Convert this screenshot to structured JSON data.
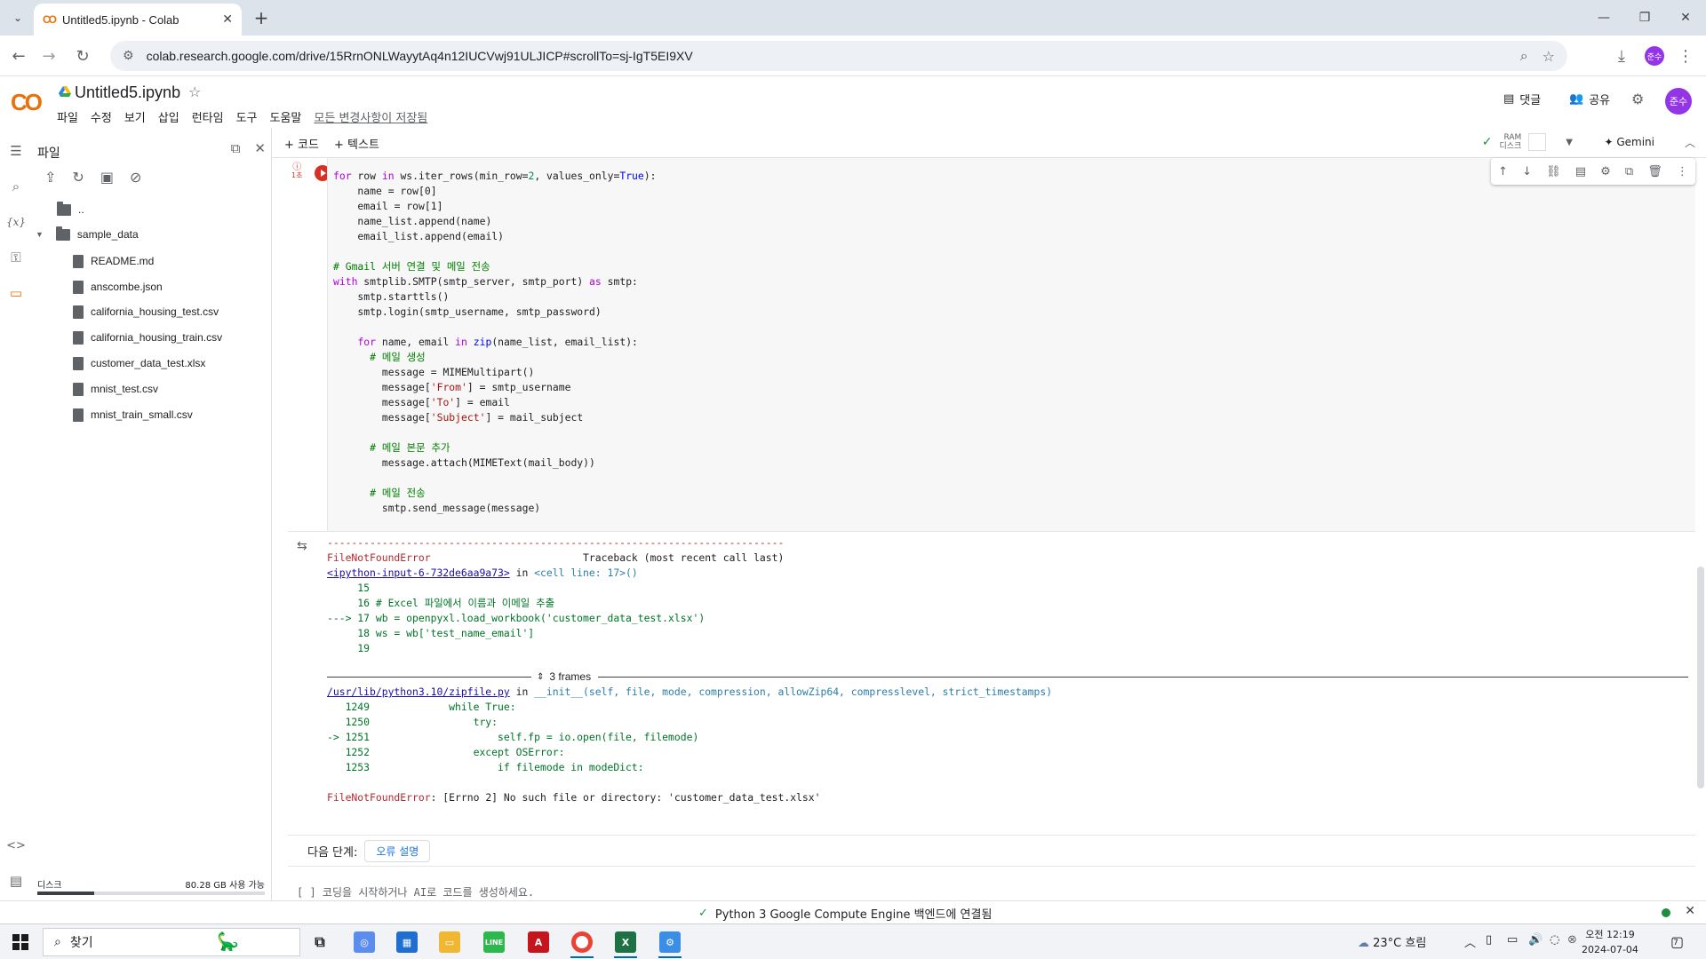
{
  "browser": {
    "tab_title": "Untitled5.ipynb - Colab",
    "tab_logo": "CO",
    "url": "colab.research.google.com/drive/15RrnONLWayytAq4n12IUCVwj91ULJICP#scrollTo=sj-IgT5EI9XV",
    "profile_initials": "준수"
  },
  "colab": {
    "logo": "CO",
    "notebook_title": "Untitled5.ipynb",
    "menu": [
      "파일",
      "수정",
      "보기",
      "삽입",
      "런타임",
      "도구",
      "도움말"
    ],
    "save_status": "모든 변경사항이 저장됨",
    "comments_label": "댓글",
    "share_label": "공유",
    "profile_initials": "준수",
    "add_code_label": "+ 코드",
    "add_text_label": "+ 텍스트",
    "ram_label": "RAM",
    "disk_label": "디스크",
    "gemini_label": "Gemini"
  },
  "file_panel": {
    "title": "파일",
    "parent_dir": "..",
    "folder": "sample_data",
    "files": [
      "README.md",
      "anscombe.json",
      "california_housing_test.csv",
      "california_housing_train.csv",
      "customer_data_test.xlsx",
      "mnist_test.csv",
      "mnist_train_small.csv"
    ],
    "disk_label": "디스크",
    "disk_available": "80.28 GB 사용 가능",
    "disk_used_fraction": 0.25
  },
  "cell": {
    "exec_time": "1초",
    "code_lines": [
      "for row in ws.iter_rows(min_row=2, values_only=True):",
      "    name = row[0]",
      "    email = row[1]",
      "    name_list.append(name)",
      "    email_list.append(email)",
      "",
      "# Gmail 서버 연결 및 메일 전송",
      "with smtplib.SMTP(smtp_server, smtp_port) as smtp:",
      "    smtp.starttls()",
      "    smtp.login(smtp_username, smtp_password)",
      "",
      "    for name, email in zip(name_list, email_list):",
      "      # 메일 생성",
      "        message = MIMEMultipart()",
      "        message['From'] = smtp_username",
      "        message['To'] = email",
      "        message['Subject'] = mail_subject",
      "",
      "      # 메일 본문 추가",
      "        message.attach(MIMEText(mail_body))",
      "",
      "      # 메일 전송",
      "        smtp.send_message(message)"
    ]
  },
  "output": {
    "dashes": "---------------------------------------------------------------------------",
    "error_name": "FileNotFoundError",
    "traceback_header": "Traceback (most recent call last)",
    "input_link": "<ipython-input-6-732de6aa9a73>",
    "in_word": "in",
    "cell_ref": "<cell line: 17>()",
    "frame1_lines": [
      "     15",
      "     16 # Excel 파일에서 이름과 이메일 추출",
      "---> 17 wb = openpyxl.load_workbook('customer_data_test.xlsx')",
      "     18 ws = wb['test_name_email']",
      "     19"
    ],
    "frames_label": "3 frames",
    "zip_link": "/usr/lib/python3.10/zipfile.py",
    "zip_func": "__init__(self, file, mode, compression, allowZip64, compresslevel, strict_timestamps)",
    "frame2_lines": [
      "   1249             while True:",
      "   1250                 try:",
      "-> 1251                     self.fp = io.open(file, filemode)",
      "   1252                 except OSError:",
      "   1253                     if filemode in modeDict:"
    ],
    "final_error": "FileNotFoundError",
    "final_message": ": [Errno 2] No such file or directory: 'customer_data_test.xlsx'"
  },
  "next_steps": {
    "label": "다음 단계:",
    "button": "오류 설명"
  },
  "empty_cell_prompt": "[ ]  코딩을 시작하거나 AI로 코드를 생성하세요.",
  "status_bar": {
    "message": "Python 3 Google Compute Engine 백엔드에 연결됨",
    "connected_color": "#1e8e3e"
  },
  "taskbar": {
    "search_placeholder": "찾기",
    "weather": "23°C  흐림",
    "time": "오전 12:19",
    "date": "2024-07-04",
    "notif_count": "7"
  }
}
